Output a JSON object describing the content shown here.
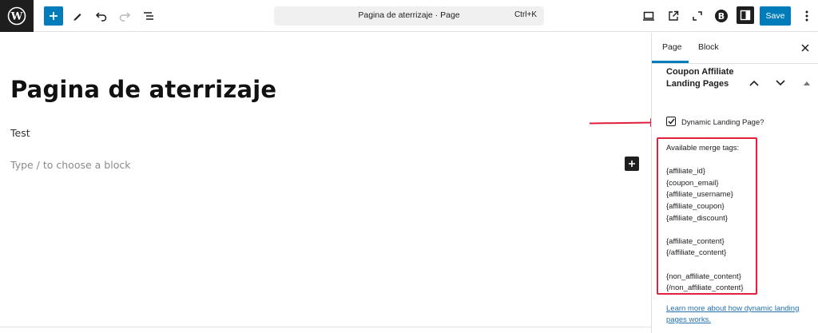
{
  "toolbar": {
    "logo_icon": "wordpress-logo",
    "add_block_icon": "plus-icon",
    "tools_icon": "pencil-icon",
    "undo_icon": "undo-icon",
    "redo_icon": "redo-icon",
    "list_view_icon": "list-view-icon",
    "document_title": "Pagina de aterrizaje · Page",
    "shortcut": "Ctrl+K",
    "preview_icon": "desktop-preview-icon",
    "view_page_icon": "external-link-icon",
    "fullscreen_icon": "fullscreen-icon",
    "plugin_icon": "plugin-b-icon",
    "settings_icon": "sidebar-settings-icon",
    "save_label": "Save",
    "options_icon": "more-vertical-icon",
    "accent_color": "#007cba"
  },
  "editor": {
    "title": "Pagina de aterrizaje",
    "paragraph": "Test",
    "placeholder": "Type / to choose a block"
  },
  "sidebar": {
    "tabs": [
      {
        "label": "Page",
        "active": true
      },
      {
        "label": "Block",
        "active": false
      }
    ],
    "panel": {
      "title": "Coupon Affiliate Landing Pages",
      "checkbox_label": "Dynamic Landing Page?",
      "checkbox_checked": true,
      "merge_tags_heading": "Available merge tags:",
      "merge_tags_group1": [
        "{affiliate_id}",
        "{coupon_email}",
        "{affiliate_username}",
        "{affiliate_coupon}",
        "{affiliate_discount}"
      ],
      "merge_tags_group2": [
        "{affiliate_content}",
        "{/affiliate_content}"
      ],
      "merge_tags_group3": [
        "{non_affiliate_content}",
        "{/non_affiliate_content}"
      ],
      "learn_more_link": "Learn more about how dynamic landing pages works.",
      "highlight_color": "#e0203c"
    }
  }
}
